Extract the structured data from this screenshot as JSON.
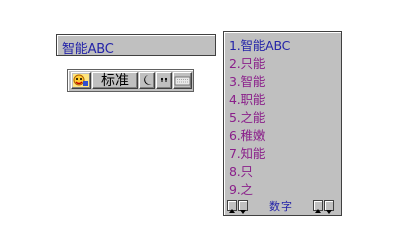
{
  "composition": {
    "text": "智能ABC"
  },
  "status_bar": {
    "ime_logo_icon": "abc-ime-logo-icon",
    "mode_label": "标准",
    "width_icon": "crescent-moon-icon",
    "punct_icon": "punctuation-icon",
    "keyboard_icon": "soft-keyboard-icon"
  },
  "candidates": {
    "items": [
      "1.智能ABC",
      "2.只能",
      "3.智能",
      "4.职能",
      "5.之能",
      "6.稚嫩",
      "7.知能",
      "8.只",
      "9.之"
    ],
    "footer_label": "数字"
  },
  "colors": {
    "text_blue": "#2323a8",
    "candidate_purple": "#8a1f8a",
    "face_gray": "#c0c0c0"
  }
}
